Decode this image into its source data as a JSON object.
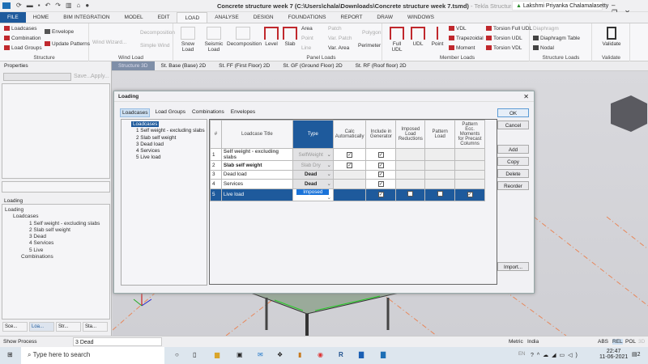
{
  "window": {
    "title": "Concrete structure week 7 (C:\\Users\\chala\\Downloads\\Concrete structure week 7.tsmd)",
    "app": " - Tekla Structural Designer Trial",
    "user": "Lakshmi Priyanka Chalamalasetty"
  },
  "menu_tabs": [
    "FILE",
    "HOME",
    "BIM INTEGRATION",
    "MODEL",
    "EDIT",
    "LOAD",
    "ANALYSE",
    "DESIGN",
    "FOUNDATIONS",
    "REPORT",
    "DRAW",
    "WINDOWS"
  ],
  "active_tab": "LOAD",
  "ribbon": {
    "structure": {
      "label": "Structure",
      "items": [
        "Loadcases",
        "Combination",
        "Load Groups",
        "Envelope",
        "Update Patterns"
      ]
    },
    "wind": {
      "label": "Wind Load",
      "items": [
        "Wind Wizard...",
        "Decomposition",
        "Simple Wind"
      ]
    },
    "snow": "Snow Load",
    "seismic": "Seismic Load",
    "decomposition": "Decomposition",
    "panel": {
      "label": "Panel Loads",
      "items": [
        "Level",
        "Slab",
        "Area",
        "Point",
        "Line",
        "Patch",
        "Var. Patch",
        "Var. Area",
        "Polygon",
        "Perimeter"
      ]
    },
    "member": {
      "label": "Member Loads",
      "items": [
        "Full UDL",
        "UDL",
        "Point",
        "VDL",
        "Trapezoidal",
        "Moment",
        "Torsion Full UDL",
        "Torsion UDL",
        "Torsion VDL"
      ]
    },
    "structure_loads": {
      "label": "Structure Loads",
      "items": [
        "Diaphragm",
        "Diaphragm Table",
        "Nodal"
      ]
    },
    "validate": {
      "label": "Validate",
      "button": "Validate"
    }
  },
  "view_tabs": [
    "Structure 3D",
    "St. Base (Base) 2D",
    "St. FF (First Floor) 2D",
    "St. GF (Ground Floor) 2D",
    "St. RF (Roof floor) 2D"
  ],
  "properties": {
    "title": "Properties",
    "save": "Save...",
    "apply": "Apply..."
  },
  "loading_panel": {
    "title": "Loading",
    "tree": [
      "Loading",
      "Loadcases",
      "1 Self weight - excluding slabs",
      "2 Slab self weight",
      "3 Dead",
      "4 Services",
      "5 Live",
      "Combinations"
    ]
  },
  "bottom_tabs": [
    "Sce...",
    "Loa...",
    "Str...",
    "Sta..."
  ],
  "dialog": {
    "title": "Loading",
    "tabs": [
      "Loadcases",
      "Load Groups",
      "Combinations",
      "Envelopes"
    ],
    "tree": [
      "Loadcases",
      "1 Self weight - excluding slabs",
      "2 Slab self weight",
      "3 Dead load",
      "4 Services",
      "5 Live load"
    ],
    "columns": [
      "#",
      "Loadcase Title",
      "Type",
      "Calc Automatically",
      "Include in Generator",
      "Imposed Load Reductions",
      "Pattern Load",
      "Pattern Ecc. Moments for Precast Columns"
    ],
    "rows": [
      {
        "n": "1",
        "title": "Self weight - excluding slabs",
        "type": "SelfWeight",
        "calc": true,
        "include": true,
        "imposed": null,
        "pattern": null,
        "ecc": null
      },
      {
        "n": "2",
        "title": "Slab self weight",
        "type": "Slab Dry",
        "calc": true,
        "include": true,
        "imposed": null,
        "pattern": null,
        "ecc": null
      },
      {
        "n": "3",
        "title": "Dead load",
        "type": "Dead",
        "calc": null,
        "include": true,
        "imposed": null,
        "pattern": null,
        "ecc": null
      },
      {
        "n": "4",
        "title": "Services",
        "type": "Dead",
        "calc": null,
        "include": true,
        "imposed": null,
        "pattern": null,
        "ecc": null
      },
      {
        "n": "5",
        "title": "Live load",
        "type": "Imposed",
        "calc": null,
        "include": true,
        "imposed": false,
        "pattern": false,
        "ecc": true
      }
    ],
    "buttons": [
      "OK",
      "Cancel",
      "Add",
      "Copy",
      "Delete",
      "Reorder",
      "Import..."
    ]
  },
  "status": {
    "show_process": "Show Process",
    "current": "3 Dead",
    "units": "Metric",
    "region": "India",
    "modes": [
      "ABS",
      "REL",
      "POL",
      "3D"
    ]
  },
  "taskbar": {
    "search_placeholder": "Type here to search",
    "lang": "EN",
    "time": "22:47",
    "date": "11-06-2021",
    "notifications": "2"
  },
  "colors": {
    "accent": "#1e5a9c",
    "load_red": "#c0282d"
  }
}
